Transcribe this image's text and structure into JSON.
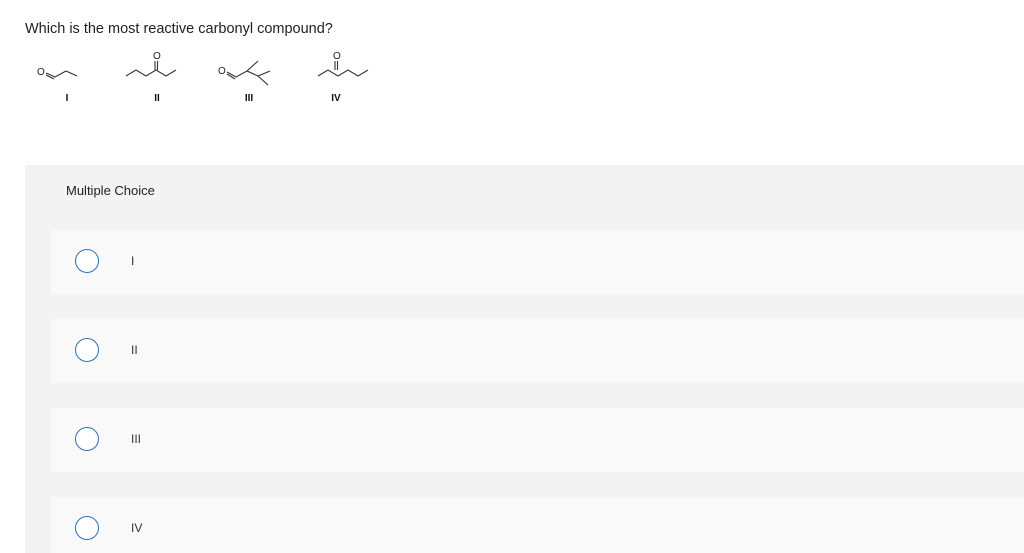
{
  "question": {
    "text": "Which is the most reactive carbonyl compound?"
  },
  "structures": {
    "atom_symbol": "O",
    "labels": [
      "I",
      "II",
      "III",
      "IV"
    ]
  },
  "multiple_choice": {
    "header": "Multiple Choice",
    "accent_color": "#2f6fb5",
    "options": [
      {
        "label": "I",
        "selected": false
      },
      {
        "label": "II",
        "selected": false
      },
      {
        "label": "III",
        "selected": false
      },
      {
        "label": "IV",
        "selected": false
      }
    ]
  }
}
